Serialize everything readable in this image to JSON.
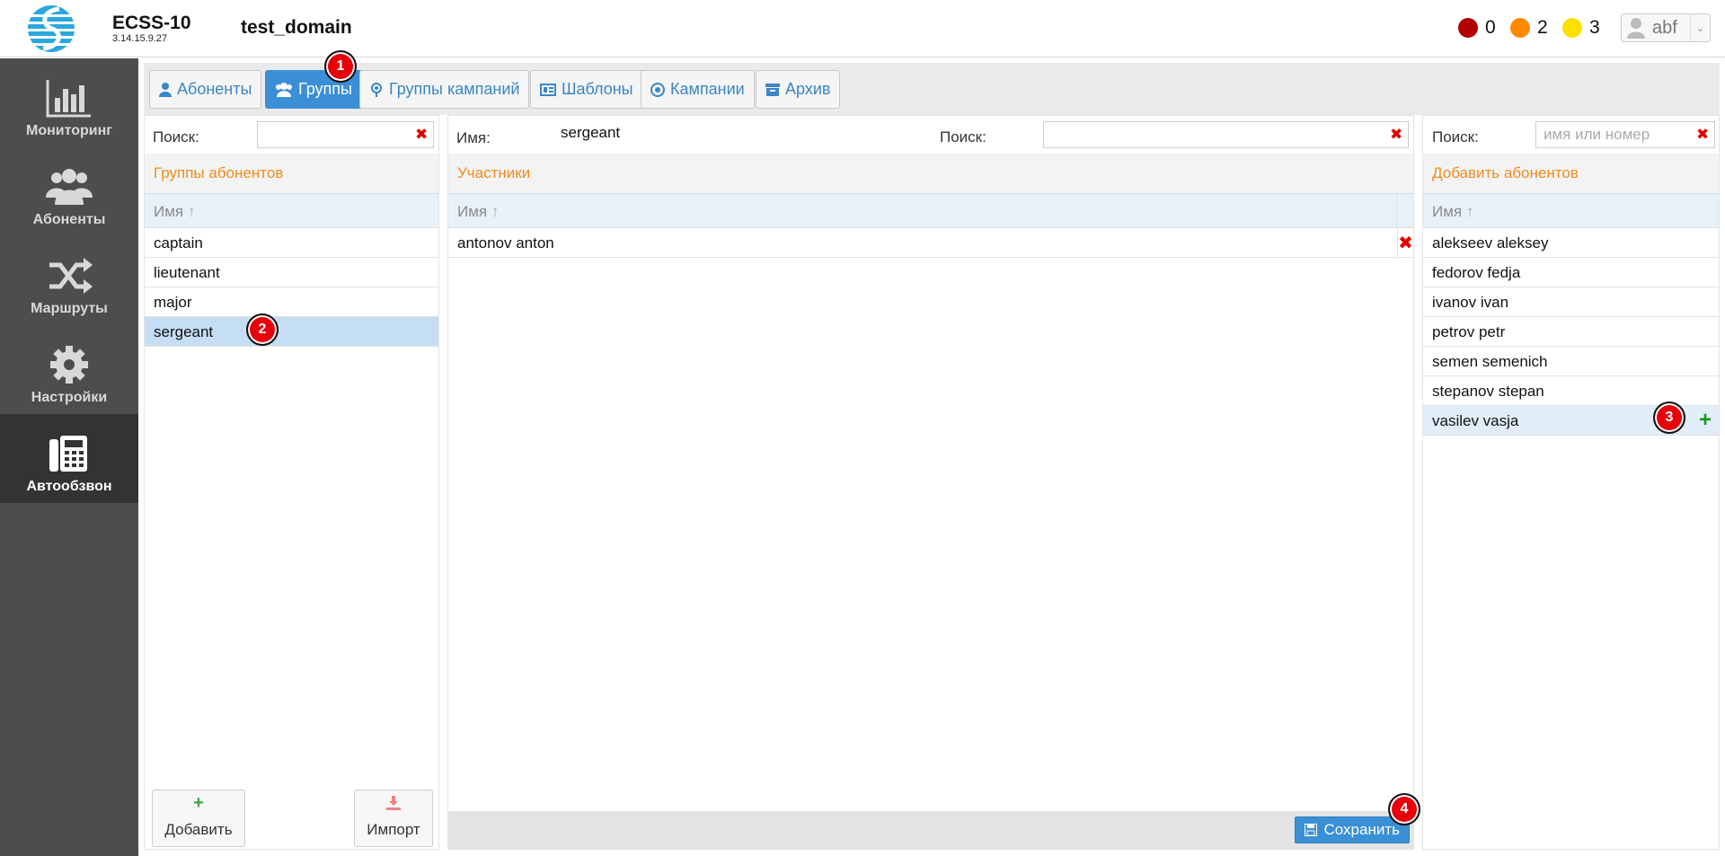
{
  "header": {
    "app_name": "ECSS-10",
    "version": "3.14.15.9.27",
    "domain": "test_domain",
    "alarms": [
      {
        "color": "#b30000",
        "count": "0"
      },
      {
        "color": "#ff8a00",
        "count": "2"
      },
      {
        "color": "#ffe000",
        "count": "3"
      }
    ],
    "user": "abf"
  },
  "sidebar": {
    "items": [
      {
        "label": "Мониторинг",
        "icon": "bar-chart-icon"
      },
      {
        "label": "Абоненты",
        "icon": "users-icon"
      },
      {
        "label": "Маршруты",
        "icon": "shuffle-icon"
      },
      {
        "label": "Настройки",
        "icon": "gear-icon"
      },
      {
        "label": "Автообзвон",
        "icon": "phone-icon",
        "active": true
      }
    ]
  },
  "tabs": [
    {
      "label": "Абоненты",
      "icon": "user-icon"
    },
    {
      "label": "Группы",
      "icon": "group-icon",
      "active": true
    },
    {
      "label": "Группы кампаний",
      "icon": "pin-icon"
    },
    {
      "label": "Шаблоны",
      "icon": "template-icon"
    },
    {
      "label": "Кампании",
      "icon": "target-icon"
    },
    {
      "label": "Архив",
      "icon": "archive-icon"
    }
  ],
  "markers": [
    "1",
    "2",
    "3",
    "4"
  ],
  "left_panel": {
    "search_label": "Поиск:",
    "search_value": "",
    "title": "Группы абонентов",
    "column": "Имя",
    "rows": [
      "captain",
      "lieutenant",
      "major",
      "sergeant"
    ],
    "selected": "sergeant",
    "add_label": "Добавить",
    "import_label": "Импорт"
  },
  "middle_panel": {
    "name_label": "Имя:",
    "name_value": "sergeant",
    "search_label": "Поиск:",
    "search_value": "",
    "title": "Участники",
    "column": "Имя",
    "rows": [
      "antonov anton"
    ],
    "save_label": "Сохранить"
  },
  "right_panel": {
    "search_label": "Поиск:",
    "search_placeholder": "имя или номер",
    "title": "Добавить абонентов",
    "column": "Имя",
    "rows": [
      "alekseev aleksey",
      "fedorov fedja",
      "ivanov ivan",
      "petrov petr",
      "semen semenich",
      "stepanov stepan",
      "vasilev vasja"
    ],
    "hover": "vasilev vasja"
  }
}
